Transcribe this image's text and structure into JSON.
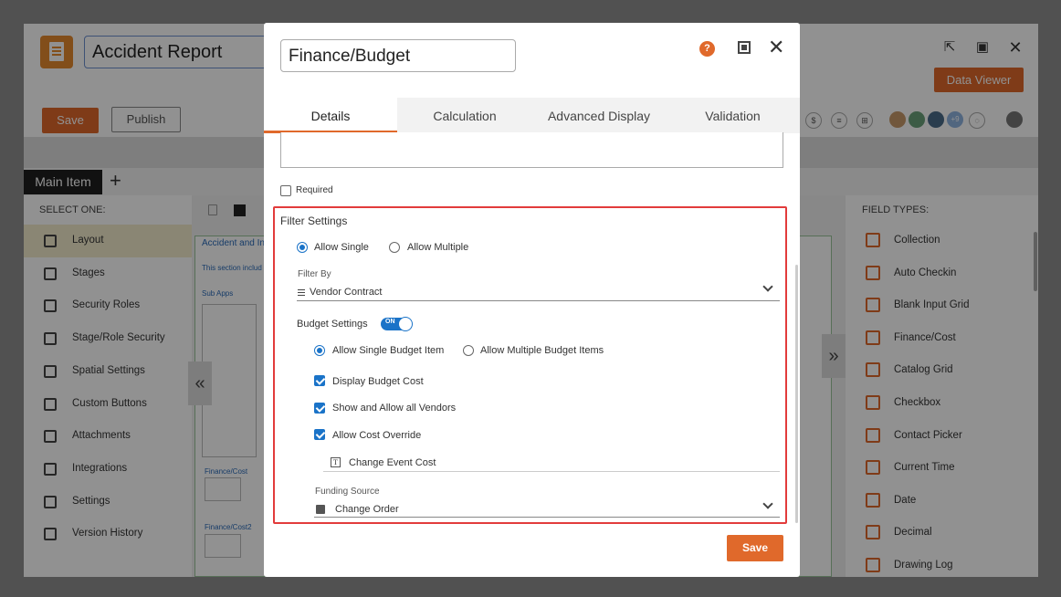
{
  "app": {
    "title": "Accident Report",
    "save_label": "Save",
    "publish_label": "Publish",
    "data_viewer_label": "Data Viewer",
    "avatar_extra_count": "+9",
    "main_tab_label": "Main Item",
    "add_tab_label": "+"
  },
  "left_nav": {
    "heading": "SELECT ONE:",
    "items": [
      {
        "label": "Layout",
        "active": true
      },
      {
        "label": "Stages"
      },
      {
        "label": "Security Roles"
      },
      {
        "label": "Stage/Role Security"
      },
      {
        "label": "Spatial Settings"
      },
      {
        "label": "Custom Buttons"
      },
      {
        "label": "Attachments"
      },
      {
        "label": "Integrations"
      },
      {
        "label": "Settings"
      },
      {
        "label": "Version History"
      }
    ]
  },
  "canvas": {
    "section_title": "Accident and Inj",
    "section_note": "This section includ",
    "sub_apps_label": "Sub Apps",
    "finance_cost_label": "Finance/Cost",
    "finance_cost2_label": "Finance/Cost2"
  },
  "field_types": {
    "heading": "FIELD TYPES:",
    "items": [
      {
        "label": "Collection"
      },
      {
        "label": "Auto Checkin"
      },
      {
        "label": "Blank Input Grid"
      },
      {
        "label": "Finance/Cost"
      },
      {
        "label": "Catalog Grid"
      },
      {
        "label": "Checkbox"
      },
      {
        "label": "Contact Picker"
      },
      {
        "label": "Current Time"
      },
      {
        "label": "Date"
      },
      {
        "label": "Decimal"
      },
      {
        "label": "Drawing Log"
      }
    ]
  },
  "modal": {
    "title": "Finance/Budget",
    "help_label": "?",
    "tabs": [
      {
        "label": "Details",
        "active": true
      },
      {
        "label": "Calculation"
      },
      {
        "label": "Advanced Display"
      },
      {
        "label": "Validation"
      }
    ],
    "required_label": "Required",
    "filter_settings": {
      "title": "Filter Settings",
      "allow_single_label": "Allow Single",
      "allow_multiple_label": "Allow Multiple",
      "selected": "Allow Single",
      "filter_by_label": "Filter By",
      "filter_by_value": "Vendor Contract"
    },
    "budget_settings": {
      "title": "Budget Settings",
      "toggle_text": "ON",
      "toggle_on": true,
      "single_item_label": "Allow Single Budget Item",
      "multiple_items_label": "Allow Multiple Budget Items",
      "selected": "Allow Single Budget Item",
      "display_cost_label": "Display Budget Cost",
      "show_vendors_label": "Show and Allow all Vendors",
      "cost_override_label": "Allow Cost Override",
      "change_event_cost_label": "Change Event Cost",
      "funding_source_label": "Funding Source",
      "funding_source_value": "Change Order"
    },
    "save_label": "Save"
  },
  "colors": {
    "accent": "#e0692b",
    "primary_blue": "#1a73c8",
    "highlight_red": "#e23b3b"
  }
}
